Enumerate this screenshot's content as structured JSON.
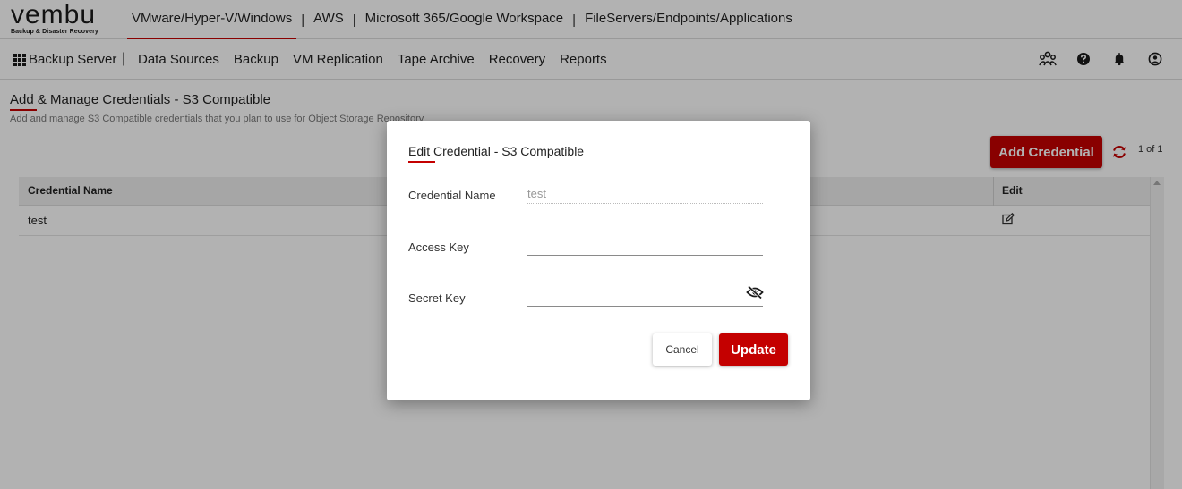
{
  "brand": {
    "name": "vembu",
    "tagline": "Backup & Disaster Recovery"
  },
  "top_nav": {
    "items": [
      {
        "label": "VMware/Hyper-V/Windows",
        "active": true
      },
      {
        "label": "AWS",
        "active": false
      },
      {
        "label": "Microsoft 365/Google Workspace",
        "active": false
      },
      {
        "label": "FileServers/Endpoints/Applications",
        "active": false
      }
    ],
    "separator": "|"
  },
  "main_nav": {
    "home_label": "Backup Server",
    "separator": "|",
    "items": [
      {
        "label": "Data Sources"
      },
      {
        "label": "Backup"
      },
      {
        "label": "VM Replication"
      },
      {
        "label": "Tape Archive"
      },
      {
        "label": "Recovery"
      },
      {
        "label": "Reports"
      }
    ],
    "right_icons": [
      "users-icon",
      "help-icon",
      "bell-icon",
      "account-icon"
    ]
  },
  "page": {
    "title": "Add & Manage Credentials - S3 Compatible",
    "subtitle": "Add and manage S3 Compatible credentials that you plan to use for Object Storage Repository",
    "add_button": "Add Credential",
    "pagination": "1 of 1"
  },
  "table": {
    "columns": [
      "Credential Name",
      "Edit"
    ],
    "rows": [
      {
        "name": "test"
      }
    ]
  },
  "modal": {
    "title": "Edit Credential - S3 Compatible",
    "fields": {
      "credential_name": {
        "label": "Credential Name",
        "value": "test"
      },
      "access_key": {
        "label": "Access Key",
        "value": ""
      },
      "secret_key": {
        "label": "Secret Key",
        "value": ""
      }
    },
    "cancel_label": "Cancel",
    "update_label": "Update"
  },
  "colors": {
    "accent": "#c40000",
    "overlay": "rgba(0,0,0,0.30)"
  }
}
